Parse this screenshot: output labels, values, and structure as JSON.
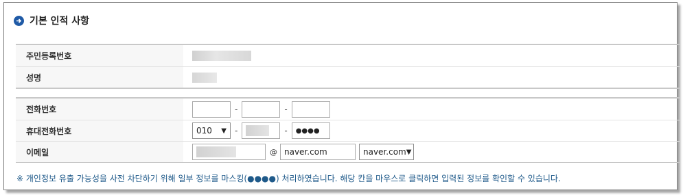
{
  "section": {
    "title": "기본 인적 사항",
    "icon": "arrow-circle-right-icon",
    "accent": "#1f5aa6"
  },
  "basic": {
    "ssn_label": "주민등록번호",
    "name_label": "성명"
  },
  "contact": {
    "phone_label": "전화번호",
    "phone_sep1": "-",
    "phone_sep2": "-",
    "mobile_label": "휴대전화번호",
    "mobile_prefix": "010",
    "mobile_sep1": "-",
    "mobile_sep2": "-",
    "mobile_last": "●●●●",
    "email_label": "이메일",
    "email_at": "@",
    "email_domain": "naver.com",
    "email_domain_select": "naver.com"
  },
  "notice": "※ 개인정보 유출 가능성을 사전 차단하기 위해 일부 정보를 마스킹(●●●●) 처리하였습니다. 해당 칸을 마우스로 클릭하면 입력된 정보를 확인할 수 있습니다."
}
